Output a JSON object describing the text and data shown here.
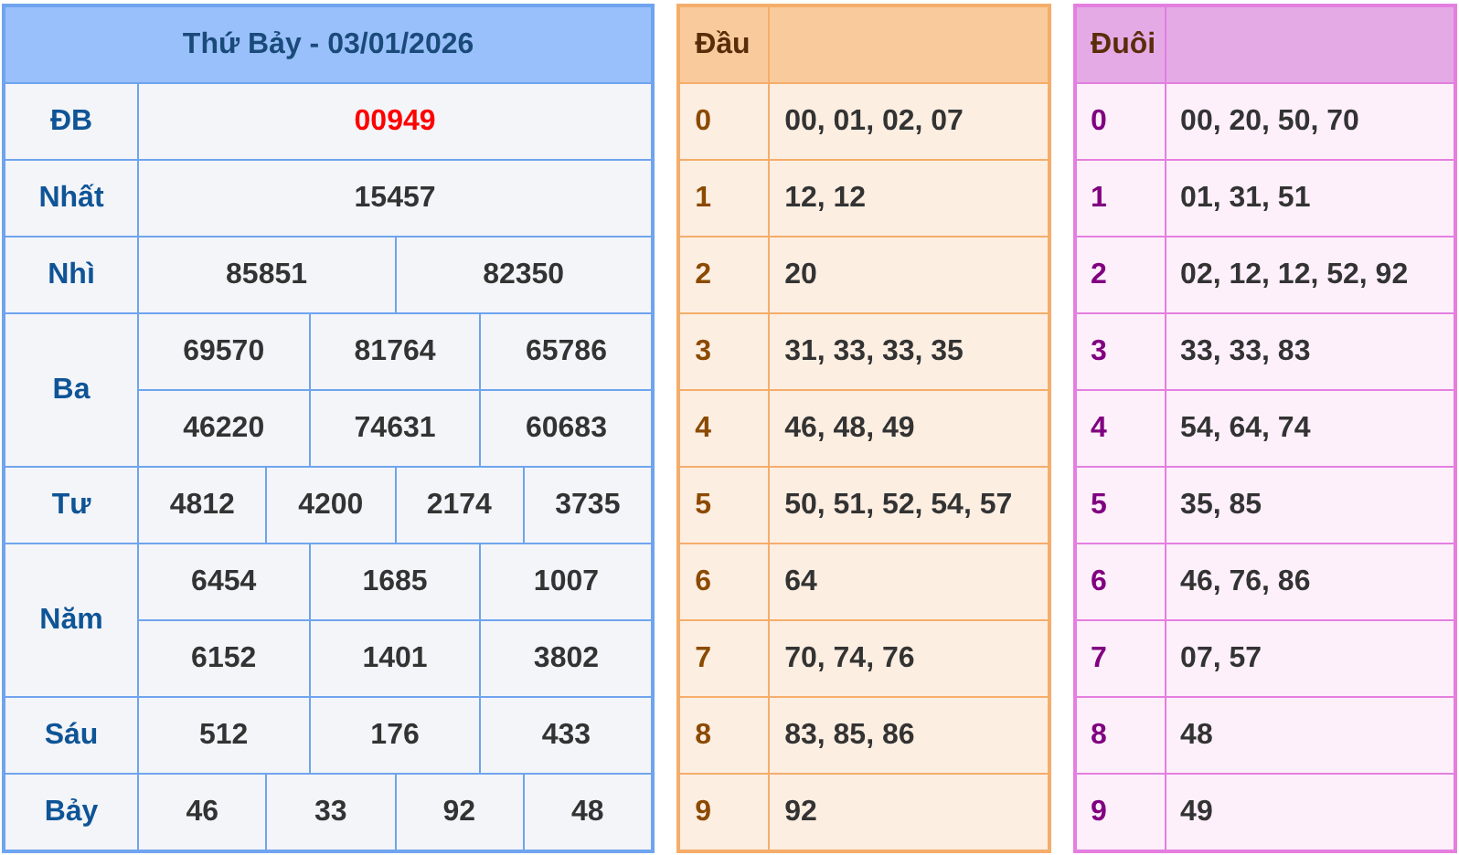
{
  "results": {
    "title": "Thứ Bảy - 03/01/2026",
    "prizes": [
      {
        "name": "ĐB",
        "kind": "special",
        "lines": [
          [
            "00949"
          ]
        ]
      },
      {
        "name": "Nhất",
        "kind": "normal",
        "lines": [
          [
            "15457"
          ]
        ]
      },
      {
        "name": "Nhì",
        "kind": "normal",
        "lines": [
          [
            "85851",
            "82350"
          ]
        ]
      },
      {
        "name": "Ba",
        "kind": "normal",
        "lines": [
          [
            "69570",
            "81764",
            "65786"
          ],
          [
            "46220",
            "74631",
            "60683"
          ]
        ]
      },
      {
        "name": "Tư",
        "kind": "normal",
        "lines": [
          [
            "4812",
            "4200",
            "2174",
            "3735"
          ]
        ]
      },
      {
        "name": "Năm",
        "kind": "normal",
        "lines": [
          [
            "6454",
            "1685",
            "1007"
          ],
          [
            "6152",
            "1401",
            "3802"
          ]
        ]
      },
      {
        "name": "Sáu",
        "kind": "normal",
        "lines": [
          [
            "512",
            "176",
            "433"
          ]
        ]
      },
      {
        "name": "Bảy",
        "kind": "normal",
        "lines": [
          [
            "46",
            "33",
            "92",
            "48"
          ]
        ]
      }
    ]
  },
  "head_table": {
    "title": "Đầu",
    "rows": [
      {
        "digit": "0",
        "numbers": "00, 01, 02, 07"
      },
      {
        "digit": "1",
        "numbers": "12, 12"
      },
      {
        "digit": "2",
        "numbers": "20"
      },
      {
        "digit": "3",
        "numbers": "31, 33, 33, 35"
      },
      {
        "digit": "4",
        "numbers": "46, 48, 49"
      },
      {
        "digit": "5",
        "numbers": "50, 51, 52, 54, 57"
      },
      {
        "digit": "6",
        "numbers": "64"
      },
      {
        "digit": "7",
        "numbers": "70, 74, 76"
      },
      {
        "digit": "8",
        "numbers": "83, 85, 86"
      },
      {
        "digit": "9",
        "numbers": "92"
      }
    ]
  },
  "tail_table": {
    "title": "Đuôi",
    "rows": [
      {
        "digit": "0",
        "numbers": "00, 20, 50, 70"
      },
      {
        "digit": "1",
        "numbers": "01, 31, 51"
      },
      {
        "digit": "2",
        "numbers": "02, 12, 12, 52, 92"
      },
      {
        "digit": "3",
        "numbers": "33, 33, 83"
      },
      {
        "digit": "4",
        "numbers": "54, 64, 74"
      },
      {
        "digit": "5",
        "numbers": "35, 85"
      },
      {
        "digit": "6",
        "numbers": "46, 76, 86"
      },
      {
        "digit": "7",
        "numbers": "07, 57"
      },
      {
        "digit": "8",
        "numbers": "48"
      },
      {
        "digit": "9",
        "numbers": "49"
      }
    ]
  }
}
